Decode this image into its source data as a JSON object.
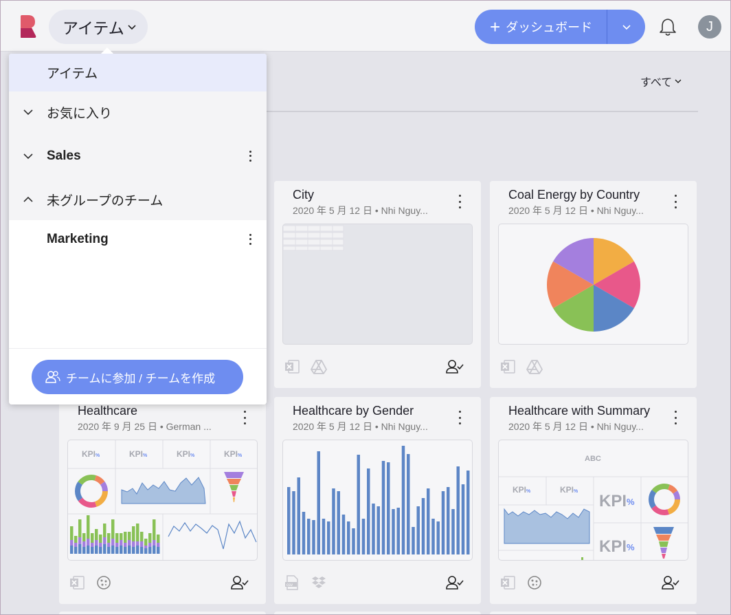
{
  "header": {
    "workspace_label": "アイテム",
    "dashboard_button_label": "ダッシュボード",
    "user_initial": "J"
  },
  "filter": {
    "label": "すべて"
  },
  "dropdown": {
    "items": [
      {
        "label": "アイテム"
      },
      {
        "label": "お気に入り"
      },
      {
        "label": "Sales"
      },
      {
        "label": "未グループのチーム"
      },
      {
        "label": "Marketing"
      }
    ],
    "join_button_label": "チームに参加 / チームを作成"
  },
  "cards": [
    {
      "title": "City",
      "meta": "2020 年 5 月 12 日 • Nhi Nguy..."
    },
    {
      "title": "Coal Energy by Country",
      "meta": "2020 年 5 月 12 日 • Nhi Nguy..."
    },
    {
      "title": "Healthcare",
      "meta": "2020 年 9 月 25 日 • German ..."
    },
    {
      "title": "Healthcare by Gender",
      "meta": "2020 年 5 月 12 日 • Nhi Nguy..."
    },
    {
      "title": "Healthcare with Summary",
      "meta": "2020 年 5 月 12 日 • Nhi Nguy..."
    }
  ],
  "thumbnail_text": {
    "kpi": "KPI",
    "pct": "%",
    "abc": "ABC",
    "csv": "csv"
  },
  "colors": {
    "accent": "#6e8df0",
    "pie": [
      "#f2ad44",
      "#e8588a",
      "#5b86c6",
      "#89c156",
      "#f0845c",
      "#a47fde"
    ],
    "bar": "#5d86c6"
  },
  "icons": {
    "logo": "reveal-logo-icon",
    "bell": "bell-icon",
    "excel": "excel-icon",
    "drive": "google-drive-icon",
    "dropbox": "dropbox-icon",
    "csv": "csv-file-icon",
    "sample": "sample-data-icon",
    "share": "shared-user-icon"
  }
}
